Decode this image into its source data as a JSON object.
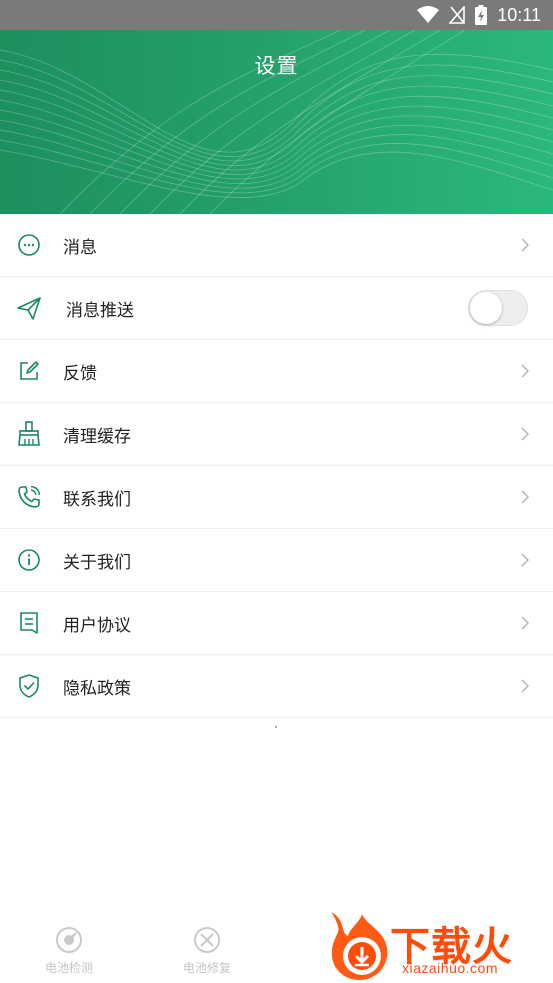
{
  "status_bar": {
    "time": "10:11"
  },
  "header": {
    "title": "设置"
  },
  "settings": [
    {
      "id": "messages",
      "label": "消息",
      "icon": "chat-bubble-icon"
    },
    {
      "id": "push",
      "label": "消息推送",
      "icon": "paper-plane-icon",
      "toggle": false
    },
    {
      "id": "feedback",
      "label": "反馈",
      "icon": "edit-icon"
    },
    {
      "id": "cache",
      "label": "清理缓存",
      "icon": "broom-icon"
    },
    {
      "id": "contact",
      "label": "联系我们",
      "icon": "phone-icon"
    },
    {
      "id": "about",
      "label": "关于我们",
      "icon": "info-icon"
    },
    {
      "id": "agreement",
      "label": "用户协议",
      "icon": "document-icon"
    },
    {
      "id": "privacy",
      "label": "隐私政策",
      "icon": "shield-check-icon"
    }
  ],
  "bottom_nav": {
    "items": [
      {
        "label": "电池检测",
        "icon": "battery-check-icon"
      },
      {
        "label": "电池修复",
        "icon": "battery-repair-icon"
      }
    ]
  },
  "watermark": {
    "brand": "下载火",
    "domain": "xiazaihuo.com"
  },
  "colors": {
    "accent": "#1f9a68",
    "icon": "#1a8a5e",
    "banner_start": "#1d8f5e",
    "banner_end": "#2cb87a"
  }
}
